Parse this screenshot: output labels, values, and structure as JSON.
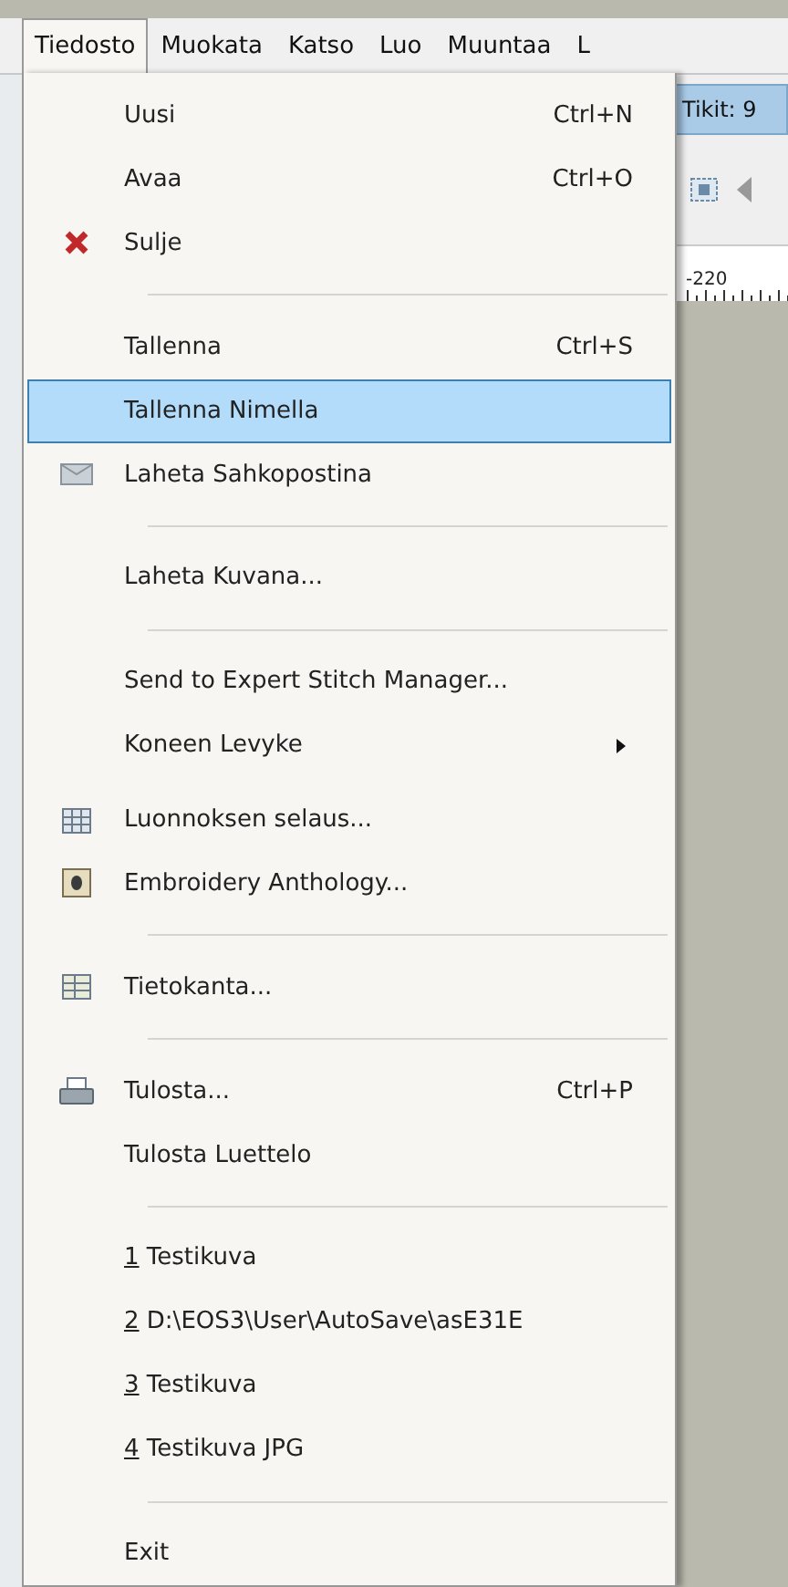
{
  "menubar": [
    {
      "label": "Tiedosto",
      "selected": true
    },
    {
      "label": "Muokata",
      "selected": false
    },
    {
      "label": "Katso",
      "selected": false
    },
    {
      "label": "Luo",
      "selected": false
    },
    {
      "label": "Muuntaa",
      "selected": false
    },
    {
      "label": "L",
      "selected": false
    }
  ],
  "status_tab": "Tikit: 9",
  "ruler_label": "-220",
  "menu": [
    {
      "kind": "item",
      "label": "Uusi",
      "shortcut": "Ctrl+N",
      "selected": false
    },
    {
      "kind": "item",
      "label": "Avaa",
      "shortcut": "Ctrl+O",
      "selected": false
    },
    {
      "kind": "item",
      "label": "Sulje",
      "selected": false
    },
    {
      "kind": "separator"
    },
    {
      "kind": "item",
      "label": "Tallenna",
      "shortcut": "Ctrl+S",
      "selected": false
    },
    {
      "kind": "item",
      "label": "Tallenna Nimella",
      "selected": true
    },
    {
      "kind": "item",
      "label": "Laheta Sahkopostina",
      "selected": false
    },
    {
      "kind": "separator"
    },
    {
      "kind": "item",
      "label": "Laheta Kuvana...",
      "selected": false
    },
    {
      "kind": "separator"
    },
    {
      "kind": "item",
      "label": "Send to Expert Stitch Manager...",
      "selected": false
    },
    {
      "kind": "item",
      "label": "Koneen Levyke",
      "submenu": true,
      "selected": false
    },
    {
      "kind": "gap"
    },
    {
      "kind": "item",
      "label": "Luonnoksen selaus...",
      "selected": false
    },
    {
      "kind": "item",
      "label": "Embroidery Anthology...",
      "selected": false
    },
    {
      "kind": "separator"
    },
    {
      "kind": "item",
      "label": "Tietokanta...",
      "selected": false
    },
    {
      "kind": "separator"
    },
    {
      "kind": "item",
      "label": "Tulosta...",
      "shortcut": "Ctrl+P",
      "selected": false
    },
    {
      "kind": "item",
      "label": "Tulosta Luettelo",
      "selected": false
    },
    {
      "kind": "separator"
    },
    {
      "kind": "item",
      "mnemonic": "1",
      "label": "Testikuva",
      "selected": false
    },
    {
      "kind": "item",
      "mnemonic": "2",
      "label": "D:\\EOS3\\User\\AutoSave\\asE31E",
      "selected": false
    },
    {
      "kind": "item",
      "mnemonic": "3",
      "label": "Testikuva",
      "selected": false
    },
    {
      "kind": "item",
      "mnemonic": "4",
      "label": "Testikuva JPG",
      "selected": false
    },
    {
      "kind": "separator"
    },
    {
      "kind": "item",
      "label": "Exit",
      "selected": false
    }
  ]
}
